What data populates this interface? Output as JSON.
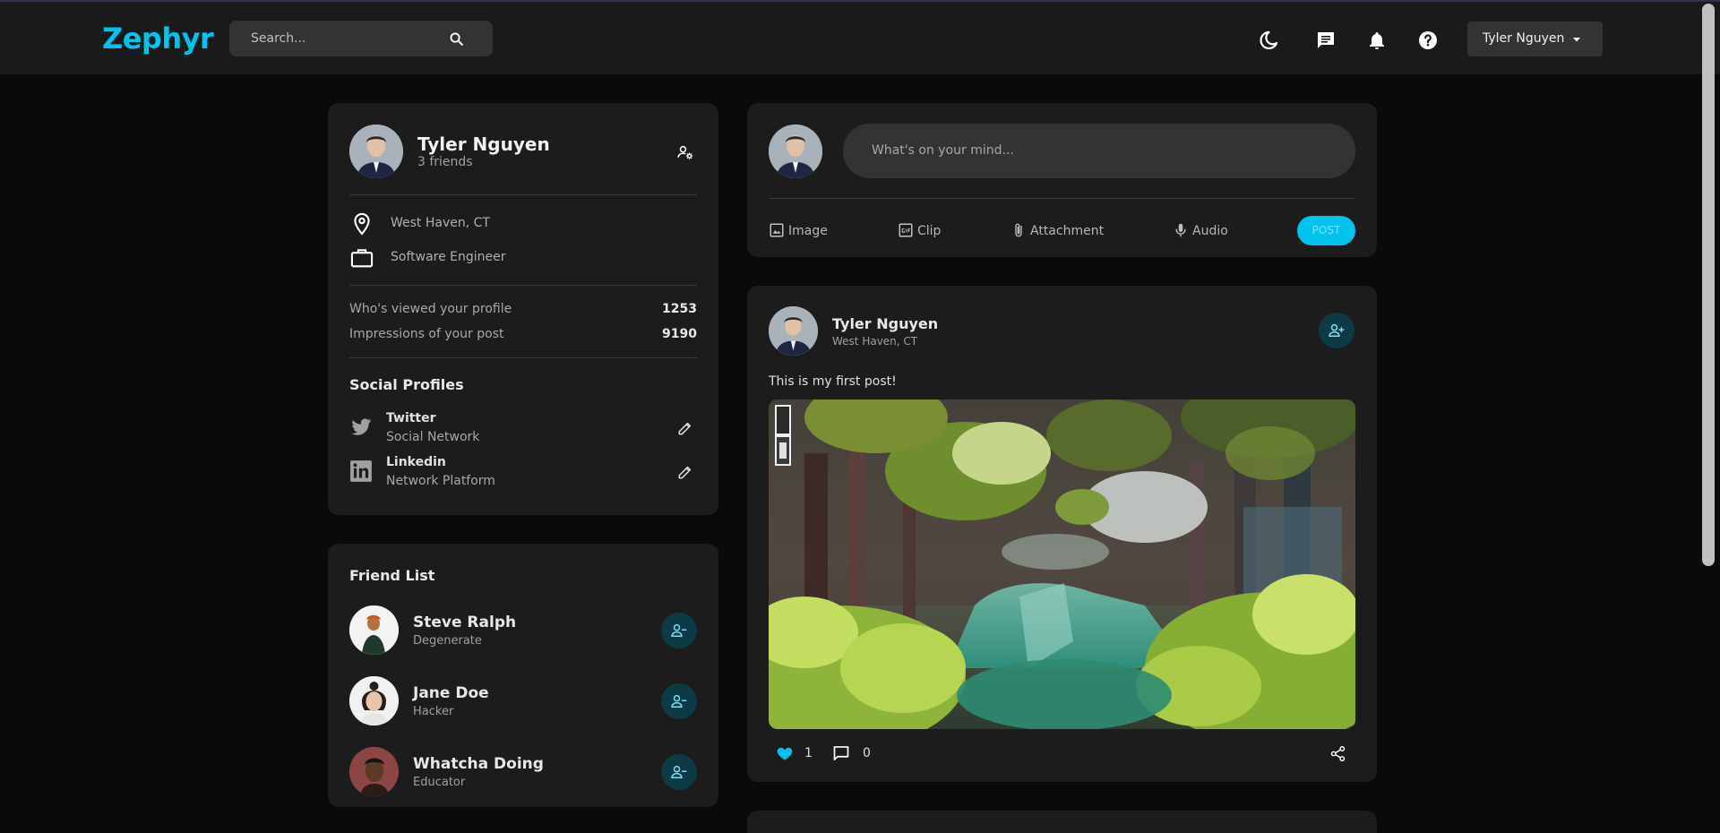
{
  "app": {
    "logo": "Zephyr"
  },
  "header": {
    "search_placeholder": "Search...",
    "user_name": "Tyler Nguyen",
    "accent_color": "#00c4ee"
  },
  "profile": {
    "name": "Tyler Nguyen",
    "friends": "3 friends",
    "location": "West Haven, CT",
    "occupation": "Software Engineer",
    "stats": [
      {
        "label": "Who's viewed your profile",
        "value": "1253"
      },
      {
        "label": "Impressions of your post",
        "value": "9190"
      }
    ],
    "social_title": "Social Profiles",
    "socials": [
      {
        "name": "Twitter",
        "subtitle": "Social Network",
        "icon": "twitter-icon"
      },
      {
        "name": "Linkedin",
        "subtitle": "Network Platform",
        "icon": "linkedin-icon"
      }
    ]
  },
  "friend_list": {
    "title": "Friend List",
    "friends": [
      {
        "name": "Steve Ralph",
        "role": "Degenerate"
      },
      {
        "name": "Jane Doe",
        "role": "Hacker"
      },
      {
        "name": "Whatcha Doing",
        "role": "Educator"
      }
    ]
  },
  "composer": {
    "placeholder": "What's on your mind...",
    "actions": [
      "Image",
      "Clip",
      "Attachment",
      "Audio"
    ],
    "post_label": "POST"
  },
  "post": {
    "author": "Tyler Nguyen",
    "location": "West Haven, CT",
    "text": "This is my first post!",
    "likes": "1",
    "comments": "0"
  }
}
